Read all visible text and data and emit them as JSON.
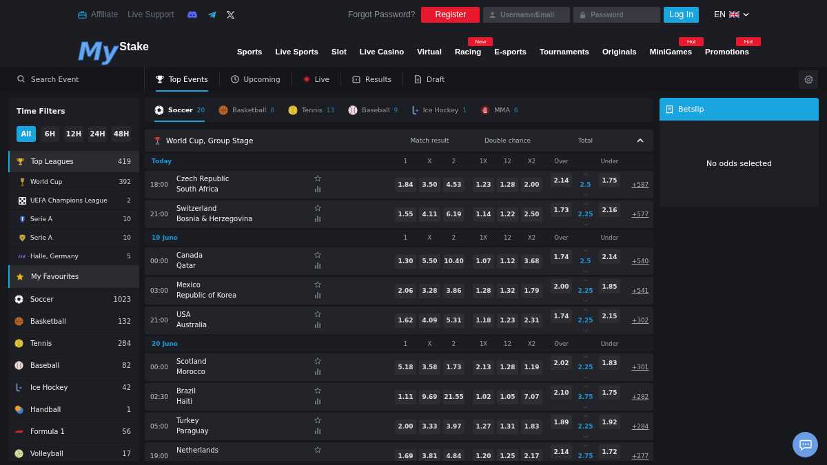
{
  "top_bar": {
    "affiliate": "Affiliate",
    "live_support": "Live Support",
    "forgot_password": "Forgot Password?",
    "register_button": "Register",
    "username_field": {
      "placeholder": "Username/Email"
    },
    "password_field": {
      "placeholder": "Password"
    },
    "login_button": "Log In",
    "language": "EN"
  },
  "logo": {
    "main": "My",
    "suffix": "Stake"
  },
  "main_nav": [
    {
      "label": "Sports"
    },
    {
      "label": "Live Sports"
    },
    {
      "label": "Slot"
    },
    {
      "label": "Live Casino"
    },
    {
      "label": "Virtual"
    },
    {
      "label": "Racing",
      "badge": "New"
    },
    {
      "label": "E-sports"
    },
    {
      "label": "Tournaments"
    },
    {
      "label": "Originals"
    },
    {
      "label": "MiniGames",
      "badge": "Hot"
    },
    {
      "label": "Promotions",
      "badge": "Hot"
    }
  ],
  "sub_nav": {
    "search": {
      "placeholder": "Search Event"
    },
    "tabs": [
      {
        "label": "Top Events",
        "selected": true
      },
      {
        "label": "Upcoming",
        "selected": false
      },
      {
        "label": "Live",
        "selected": false
      },
      {
        "label": "Results",
        "selected": false
      },
      {
        "label": "Draft",
        "selected": false
      }
    ]
  },
  "sidebar": {
    "title": "Time Filters",
    "time_filters": [
      {
        "label": "All",
        "selected": true
      },
      {
        "label": "6H",
        "selected": false
      },
      {
        "label": "12H",
        "selected": false
      },
      {
        "label": "24H",
        "selected": false
      },
      {
        "label": "48H",
        "selected": false
      }
    ],
    "top_leagues": {
      "label": "Top Leagues",
      "count": "419",
      "items": [
        {
          "label": "World Cup",
          "count": "392"
        },
        {
          "label": "UEFA Champions League",
          "count": "2"
        },
        {
          "label": "Serie A",
          "count": "10"
        },
        {
          "label": "Serie A",
          "count": "10"
        },
        {
          "label": "Halle, Germany",
          "count": "5"
        }
      ]
    },
    "favourites": {
      "label": "My Favourites"
    },
    "sports": [
      {
        "kind": "soccer",
        "label": "Soccer",
        "count": "1023"
      },
      {
        "kind": "basketball",
        "label": "Basketball",
        "count": "132"
      },
      {
        "kind": "tennis",
        "label": "Tennis",
        "count": "284"
      },
      {
        "kind": "baseball",
        "label": "Baseball",
        "count": "82"
      },
      {
        "kind": "icehockey",
        "label": "Ice Hockey",
        "count": "42"
      },
      {
        "kind": "handball",
        "label": "Handball",
        "count": "1"
      },
      {
        "kind": "formula1",
        "label": "Formula 1",
        "count": "56"
      },
      {
        "kind": "volleyball",
        "label": "Volleyball",
        "count": "17"
      }
    ]
  },
  "sport_tabs": [
    {
      "kind": "soccer",
      "label": "Soccer",
      "count": "20",
      "selected": true
    },
    {
      "kind": "basketball",
      "label": "Basketball",
      "count": "8",
      "selected": false
    },
    {
      "kind": "tennis",
      "label": "Tennis",
      "count": "13",
      "selected": false
    },
    {
      "kind": "baseball",
      "label": "Baseball",
      "count": "9",
      "selected": false
    },
    {
      "kind": "icehockey",
      "label": "Ice Hockey",
      "count": "1",
      "selected": false
    },
    {
      "kind": "mma",
      "label": "MMA",
      "count": "6",
      "selected": false
    }
  ],
  "event_group": {
    "title": "World Cup, Group Stage",
    "expanded": true,
    "markets": [
      "Match result",
      "Double chance",
      "Total"
    ],
    "days": [
      {
        "label": "Today",
        "columns": [
          "1",
          "X",
          "2",
          "1X",
          "12",
          "X2",
          "Over",
          "Under"
        ],
        "matches": [
          {
            "time": "18:00",
            "teams": [
              "Czech Republic",
              "South Africa"
            ],
            "odds": [
              "1.84",
              "3.50",
              "4.53",
              "1.23",
              "1.28",
              "2.00"
            ],
            "total": {
              "over": "2.14",
              "line": "2.5",
              "under": "1.75"
            },
            "more": "+587"
          },
          {
            "time": "21:00",
            "teams": [
              "Switzerland",
              "Bosnia & Herzegovina"
            ],
            "odds": [
              "1.55",
              "4.11",
              "6.19",
              "1.14",
              "1.22",
              "2.50"
            ],
            "total": {
              "over": "1.73",
              "line": "2.25",
              "under": "2.16"
            },
            "more": "+577"
          }
        ]
      },
      {
        "label": "19 June",
        "columns": [
          "1",
          "X",
          "2",
          "1X",
          "12",
          "X2",
          "Over",
          "Under"
        ],
        "matches": [
          {
            "time": "00:00",
            "teams": [
              "Canada",
              "Qatar"
            ],
            "odds": [
              "1.30",
              "5.50",
              "10.40",
              "1.07",
              "1.12",
              "3.68"
            ],
            "total": {
              "over": "1.74",
              "line": "2.5",
              "under": "2.14"
            },
            "more": "+540"
          },
          {
            "time": "03:00",
            "teams": [
              "Mexico",
              "Republic of Korea"
            ],
            "odds": [
              "2.06",
              "3.28",
              "3.86",
              "1.28",
              "1.32",
              "1.79"
            ],
            "total": {
              "over": "2.00",
              "line": "2.25",
              "under": "1.85"
            },
            "more": "+541"
          },
          {
            "time": "21:00",
            "teams": [
              "USA",
              "Australia"
            ],
            "odds": [
              "1.62",
              "4.09",
              "5.31",
              "1.18",
              "1.23",
              "2.31"
            ],
            "total": {
              "over": "1.74",
              "line": "2.25",
              "under": "2.15"
            },
            "more": "+302"
          }
        ]
      },
      {
        "label": "20 June",
        "columns": [
          "1",
          "X",
          "2",
          "1X",
          "12",
          "X2",
          "Over",
          "Under"
        ],
        "matches": [
          {
            "time": "00:00",
            "teams": [
              "Scotland",
              "Morocco"
            ],
            "odds": [
              "5.18",
              "3.58",
              "1.73",
              "2.13",
              "1.28",
              "1.19"
            ],
            "total": {
              "over": "2.02",
              "line": "2.25",
              "under": "1.83"
            },
            "more": "+301"
          },
          {
            "time": "02:30",
            "teams": [
              "Brazil",
              "Haiti"
            ],
            "odds": [
              "1.11",
              "9.69",
              "21.55",
              "1.02",
              "1.05",
              "7.07"
            ],
            "total": {
              "over": "2.10",
              "line": "3.75",
              "under": "1.75"
            },
            "more": "+282"
          },
          {
            "time": "05:00",
            "teams": [
              "Turkey",
              "Paraguay"
            ],
            "odds": [
              "2.00",
              "3.33",
              "3.97",
              "1.27",
              "1.31",
              "1.83"
            ],
            "total": {
              "over": "1.89",
              "line": "2.25",
              "under": "1.92"
            },
            "more": "+284"
          },
          {
            "time": "19:00",
            "teams": [
              "Netherlands"
            ],
            "odds": [
              "1.69",
              "3.81",
              "4.84",
              "1.20",
              "1.25",
              "2.17"
            ],
            "total": {
              "over": "2.14",
              "line": "2.75",
              "under": "1.72"
            },
            "more": "+277"
          }
        ]
      }
    ]
  },
  "betslip": {
    "title": "Betslip",
    "empty_text": "No odds selected"
  }
}
